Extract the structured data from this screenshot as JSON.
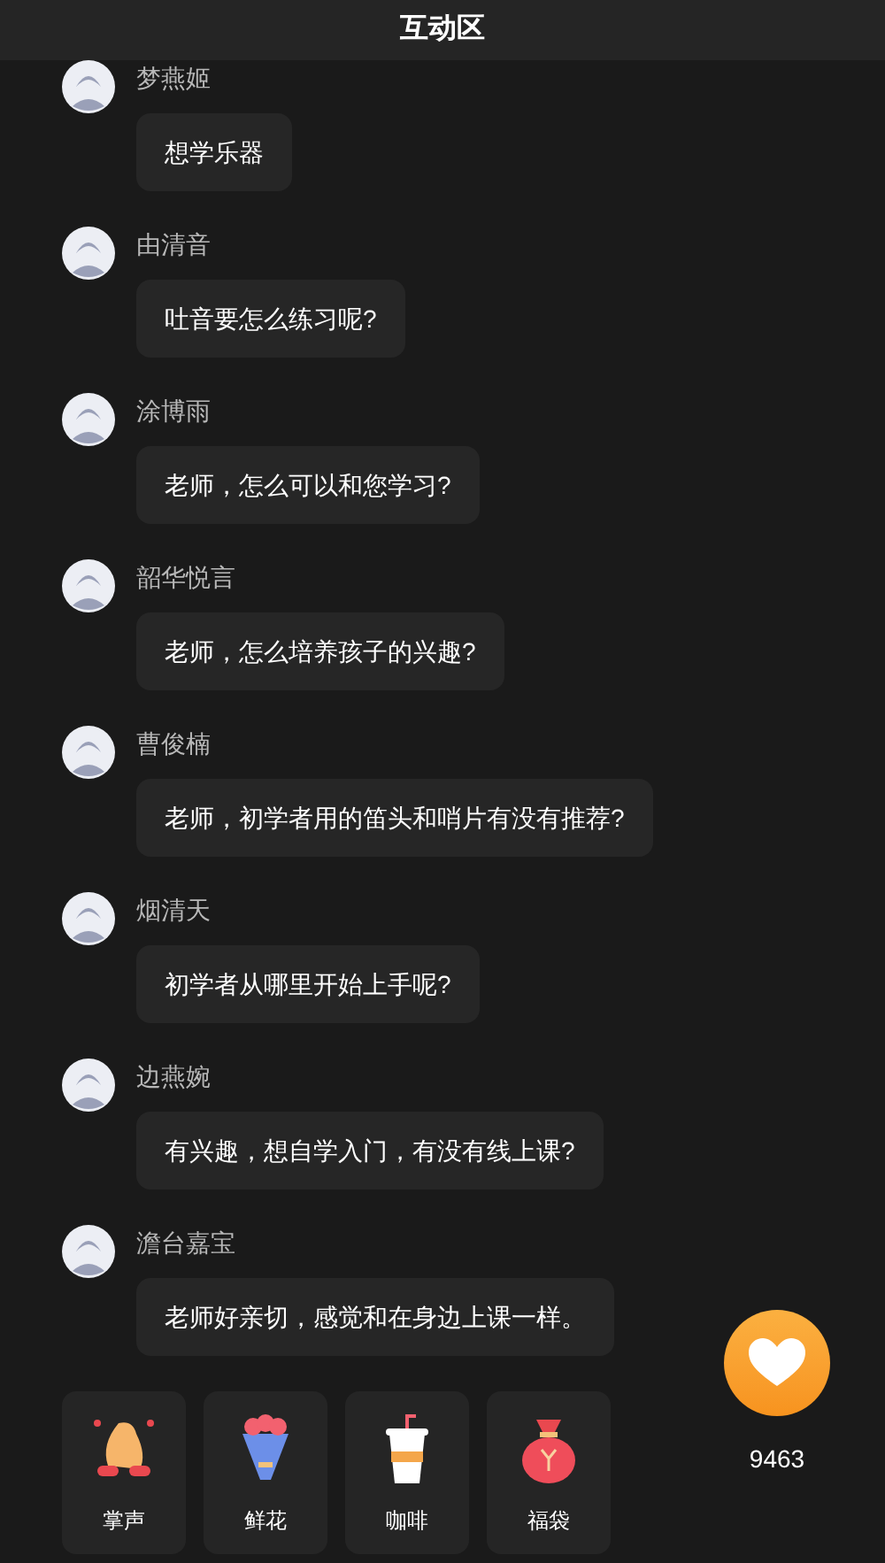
{
  "header": {
    "title": "互动区"
  },
  "messages": [
    {
      "name": "梦燕姬",
      "text": "想学乐器"
    },
    {
      "name": "由清音",
      "text": "吐音要怎么练习呢?"
    },
    {
      "name": "涂博雨",
      "text": "老师，怎么可以和您学习?"
    },
    {
      "name": "韶华悦言",
      "text": "老师，怎么培养孩子的兴趣?"
    },
    {
      "name": "曹俊楠",
      "text": "老师，初学者用的笛头和哨片有没有推荐?"
    },
    {
      "name": "烟清天",
      "text": "初学者从哪里开始上手呢?"
    },
    {
      "name": "边燕婉",
      "text": "有兴趣，想自学入门，有没有线上课?"
    },
    {
      "name": "澹台嘉宝",
      "text": "老师好亲切，感觉和在身边上课一样。"
    }
  ],
  "gifts": [
    {
      "kind": "clap",
      "label": "掌声"
    },
    {
      "kind": "flowers",
      "label": "鲜花"
    },
    {
      "kind": "coffee",
      "label": "咖啡"
    },
    {
      "kind": "bag",
      "label": "福袋"
    }
  ],
  "likes": {
    "count": "9463"
  }
}
